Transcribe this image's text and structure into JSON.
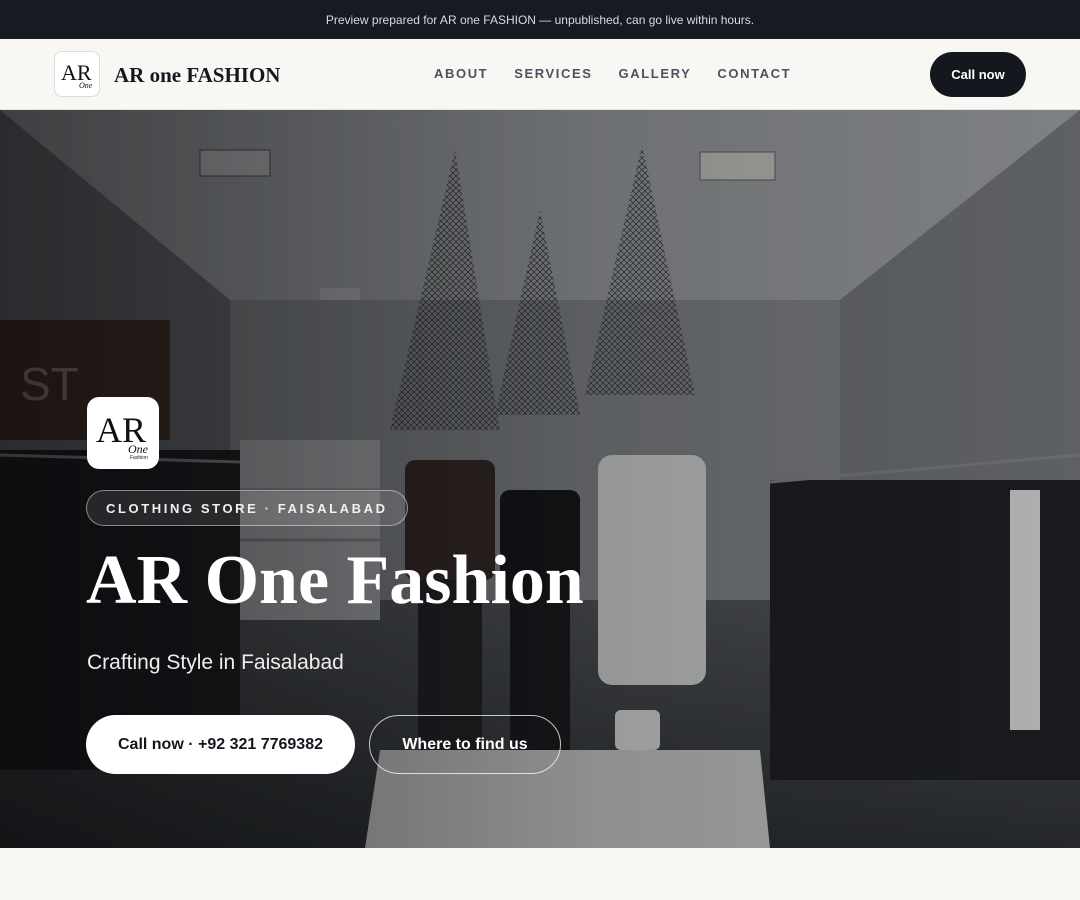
{
  "banner": {
    "text": "Preview prepared for AR one FASHION — unpublished, can go live within hours."
  },
  "nav": {
    "brand_name": "AR one FASHION",
    "logo_icon": "ar-one-fashion-logo-icon",
    "menu": [
      {
        "label": "ABOUT"
      },
      {
        "label": "SERVICES"
      },
      {
        "label": "GALLERY"
      },
      {
        "label": "CONTACT"
      }
    ],
    "cta_label": "Call now"
  },
  "hero": {
    "background": "clothing-store-interior-photo",
    "badge_icon": "ar-one-fashion-logo-icon",
    "eyebrow": "CLOTHING STORE · FAISALABAD",
    "title": "AR One Fashion",
    "subtitle": "Crafting Style in Faisalabad",
    "primary_cta": "Call now · +92 321 7769382",
    "secondary_cta": "Where to find us"
  },
  "colors": {
    "banner_bg": "#161a22",
    "nav_bg": "#f8f7f4",
    "accent_dark": "#14171d",
    "page_bg": "#f8f7f4"
  }
}
